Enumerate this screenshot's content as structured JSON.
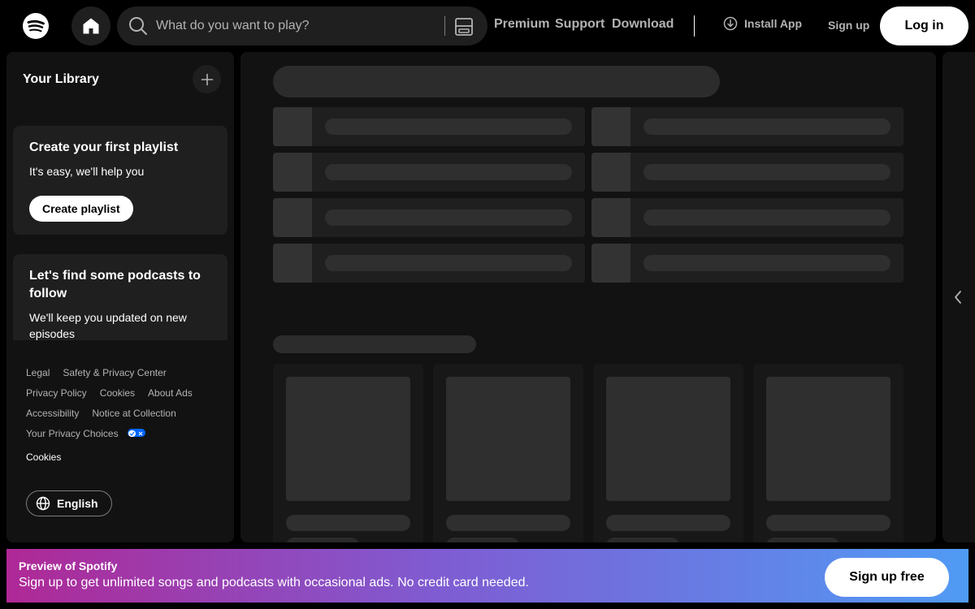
{
  "app": {
    "name": "Spotify",
    "logo_icon": "spotify-logo-icon",
    "accent_color": "#1ed760"
  },
  "header": {
    "home_icon": "home-icon",
    "search": {
      "placeholder": "What do you want to play?",
      "value": "",
      "icon": "search-icon",
      "browse_icon": "browse-icon"
    },
    "nav_links": [
      "Premium",
      "Support",
      "Download"
    ],
    "install_app": {
      "label": "Install App",
      "icon": "download-circle-icon"
    },
    "sign_up_label": "Sign up",
    "log_in_label": "Log in"
  },
  "library": {
    "title": "Your Library",
    "add_icon": "plus-icon",
    "cards": [
      {
        "title": "Create your first playlist",
        "text": "It's easy, we'll help you",
        "button": "Create playlist"
      },
      {
        "title": "Let's find some podcasts to follow",
        "text": "We'll keep you updated on new episodes"
      }
    ],
    "footer_links": [
      [
        "Legal",
        "Safety & Privacy Center"
      ],
      [
        "Privacy Policy",
        "Cookies",
        "About Ads"
      ],
      [
        "Accessibility",
        "Notice at Collection"
      ],
      [
        "Your Privacy Choices"
      ]
    ],
    "cookies_label": "Cookies",
    "language": {
      "label": "English",
      "icon": "globe-icon"
    }
  },
  "main": {
    "loading": true,
    "tile_rows": 4,
    "card_count": 4
  },
  "right_panel": {
    "expand_icon": "chevron-left-icon"
  },
  "banner": {
    "title": "Preview of Spotify",
    "text": "Sign up to get unlimited songs and podcasts with occasional ads. No credit card needed.",
    "button": "Sign up free",
    "colors": [
      "#af2896",
      "#509bf5"
    ]
  }
}
